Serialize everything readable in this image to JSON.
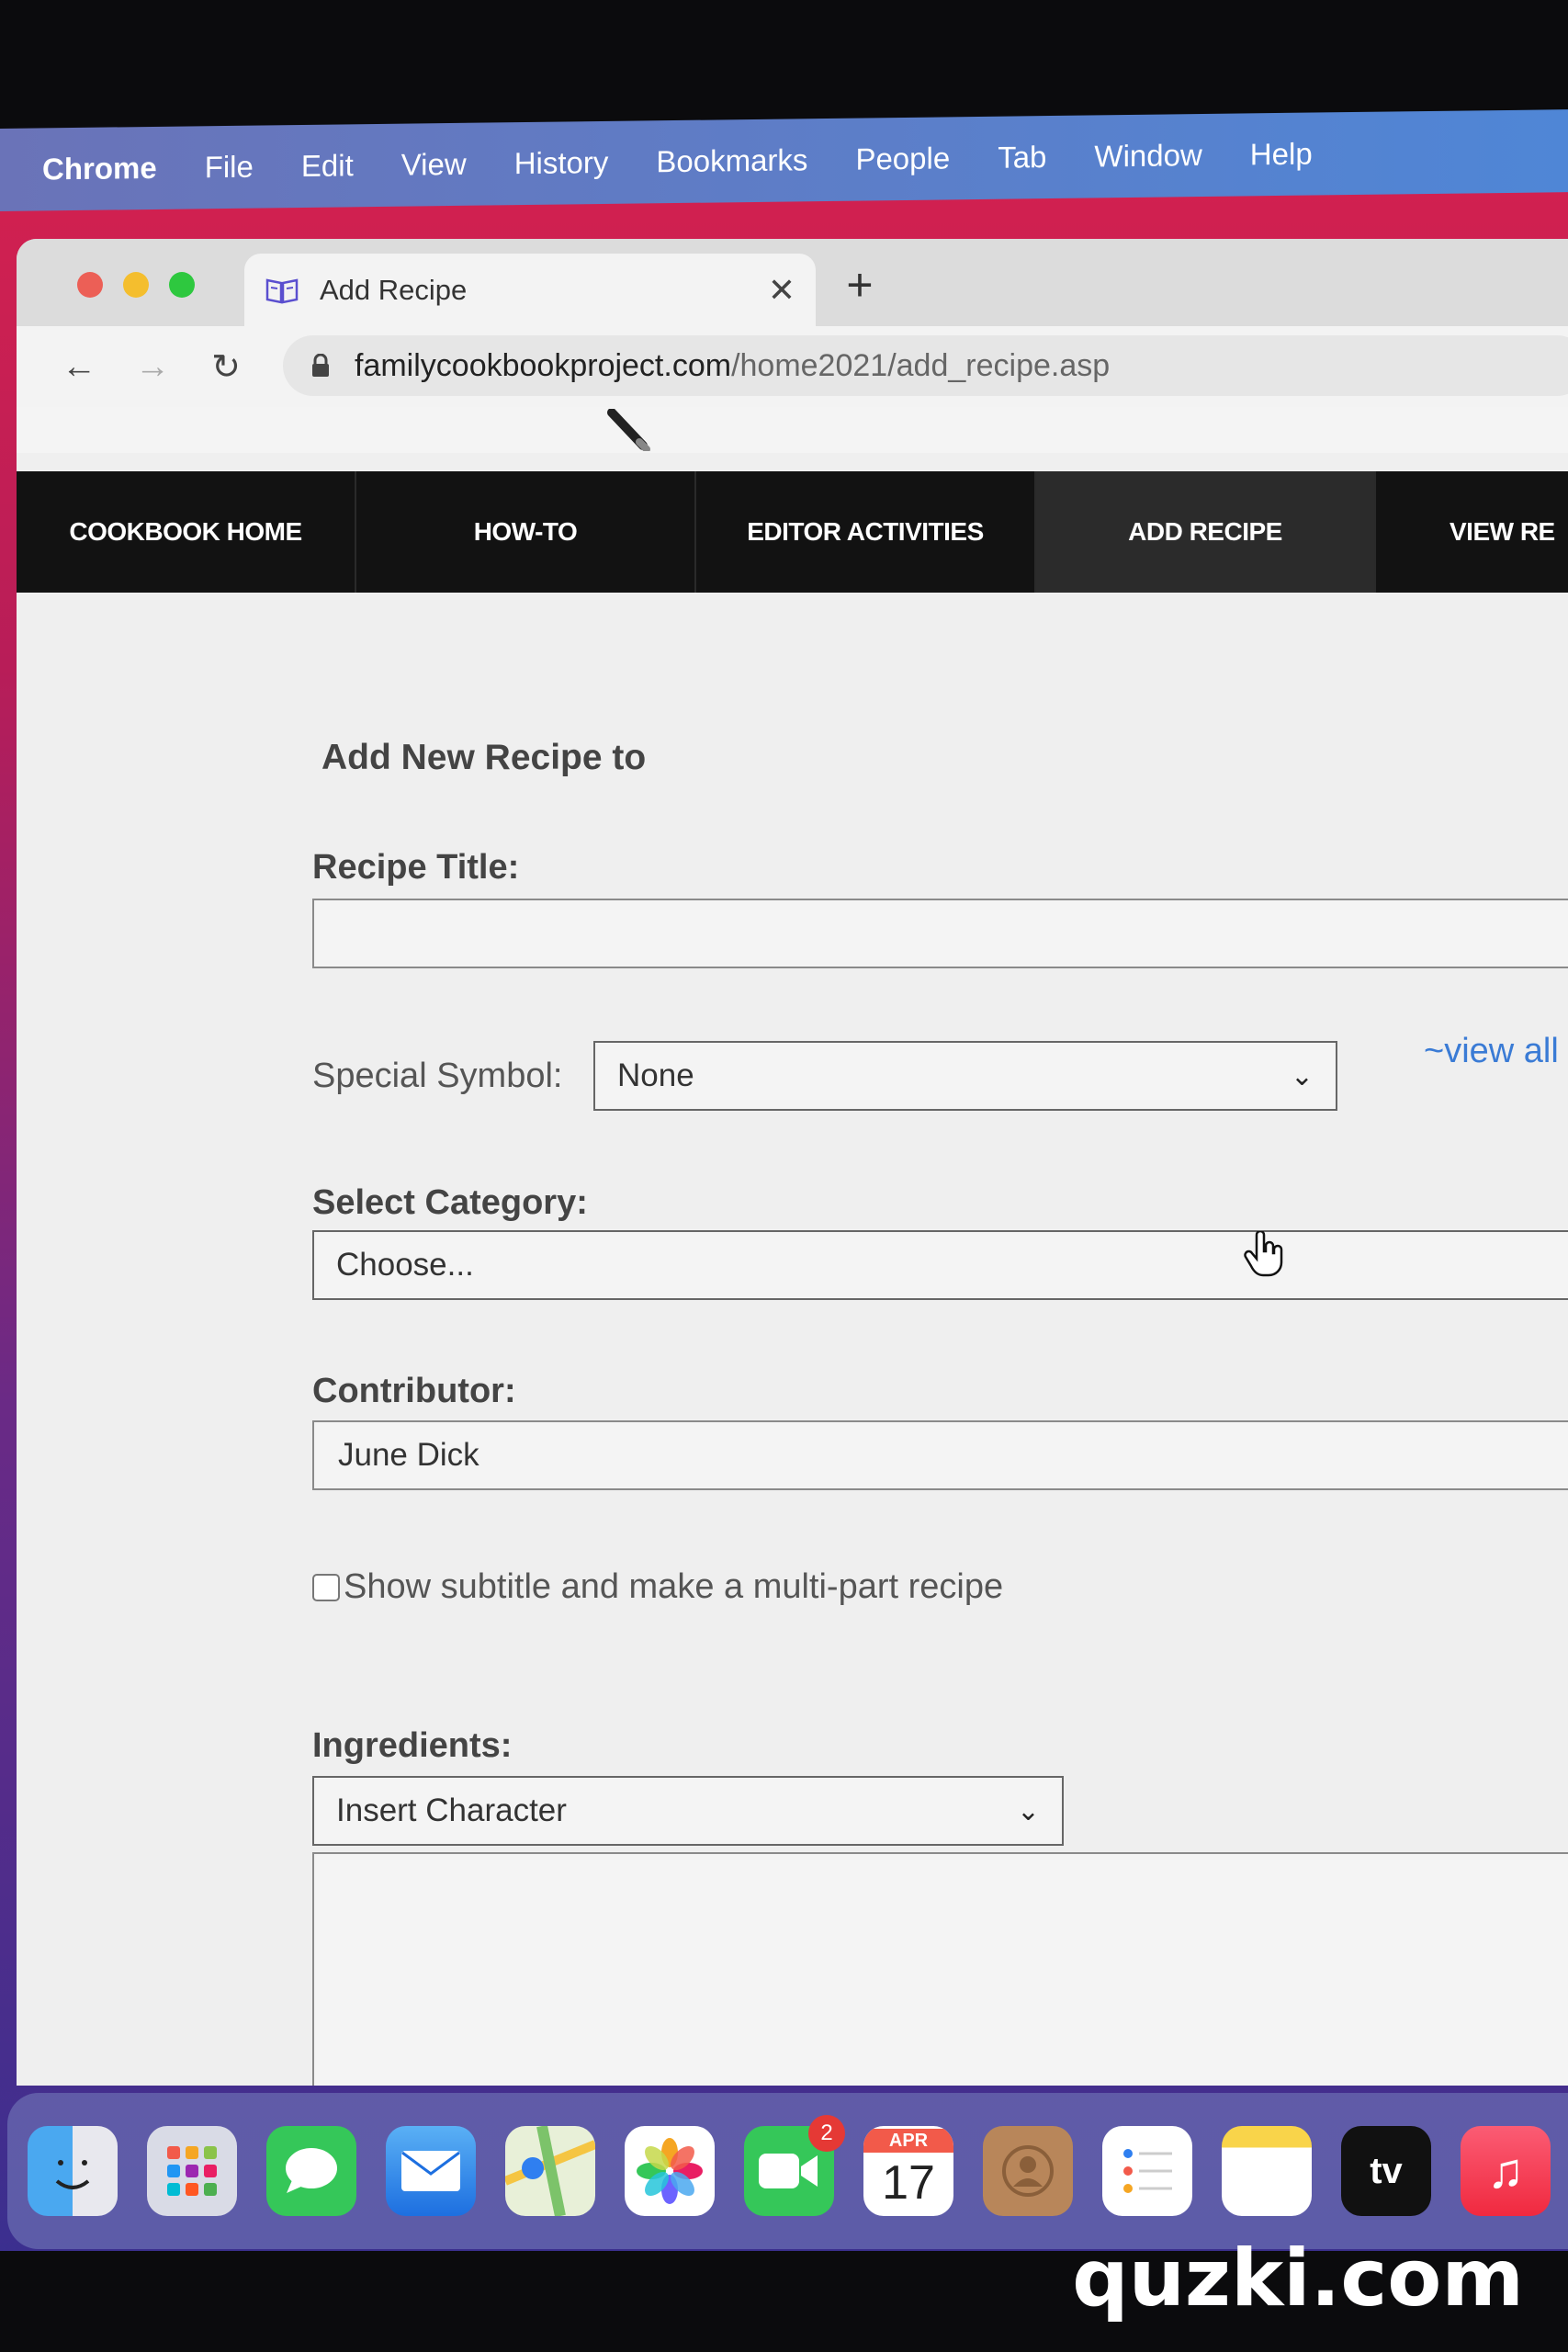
{
  "menubar": {
    "app": "Chrome",
    "items": [
      "File",
      "Edit",
      "View",
      "History",
      "Bookmarks",
      "People",
      "Tab",
      "Window",
      "Help"
    ]
  },
  "browser": {
    "tab_title": "Add Recipe",
    "url_host": "familycookbookproject.com",
    "url_path": "/home2021/add_recipe.asp",
    "traffic_lights": [
      "#ec5f56",
      "#f4be2e",
      "#2ec83f"
    ]
  },
  "site_nav": {
    "items": [
      "COOKBOOK HOME",
      "HOW-TO",
      "EDITOR ACTIVITIES",
      "ADD RECIPE",
      "VIEW RE"
    ],
    "active_index": 3
  },
  "form": {
    "heading": "Add New Recipe to",
    "recipe_title_label": "Recipe Title:",
    "recipe_title_value": "",
    "special_symbol_label": "Special Symbol:",
    "special_symbol_value": "None",
    "view_all_link": "~view all",
    "category_label": "Select Category:",
    "category_value": "Choose...",
    "contributor_label": "Contributor:",
    "contributor_value": "June Dick",
    "multipart_checkbox_label": "Show subtitle and make a multi-part recipe",
    "multipart_checked": false,
    "ingredients_label": "Ingredients:",
    "insert_character_value": "Insert Character"
  },
  "dock": {
    "calendar_month": "APR",
    "calendar_day": "17",
    "facetime_badge": "2",
    "tv_label": "tv"
  },
  "watermark": "quzki.com"
}
